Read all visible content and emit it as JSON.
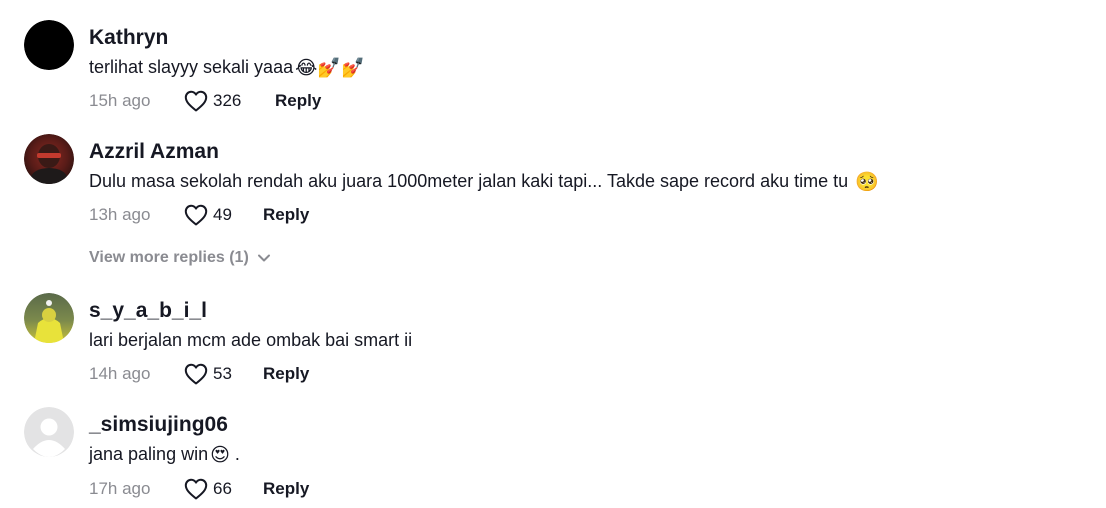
{
  "comments": [
    {
      "username": "Kathryn",
      "text": "terlihat slayyy sekali yaaa",
      "emojis": "😂💅💅",
      "time": "15h ago",
      "likes": "326",
      "reply_label": "Reply"
    },
    {
      "username": "Azzril Azman",
      "text": "Dulu masa sekolah rendah aku juara 1000meter jalan kaki tapi... Takde sape record aku time tu ",
      "emojis": "🥺",
      "time": "13h ago",
      "likes": "49",
      "reply_label": "Reply",
      "view_more": "View more replies (1)"
    },
    {
      "username": "s_y_a_b_i_l",
      "text": "lari berjalan mcm ade ombak bai smart ii",
      "time": "14h ago",
      "likes": "53",
      "reply_label": "Reply"
    },
    {
      "username": "_simsiujing06",
      "text": "jana paling win",
      "emojis": "😍",
      "text_suffix": " .",
      "time": "17h ago",
      "likes": "66",
      "reply_label": "Reply"
    }
  ],
  "colors": {
    "text_primary": "#161823",
    "text_secondary": "#8a8b91"
  },
  "icons": {
    "like": "heart-outline-icon",
    "expand": "chevron-down-icon"
  }
}
